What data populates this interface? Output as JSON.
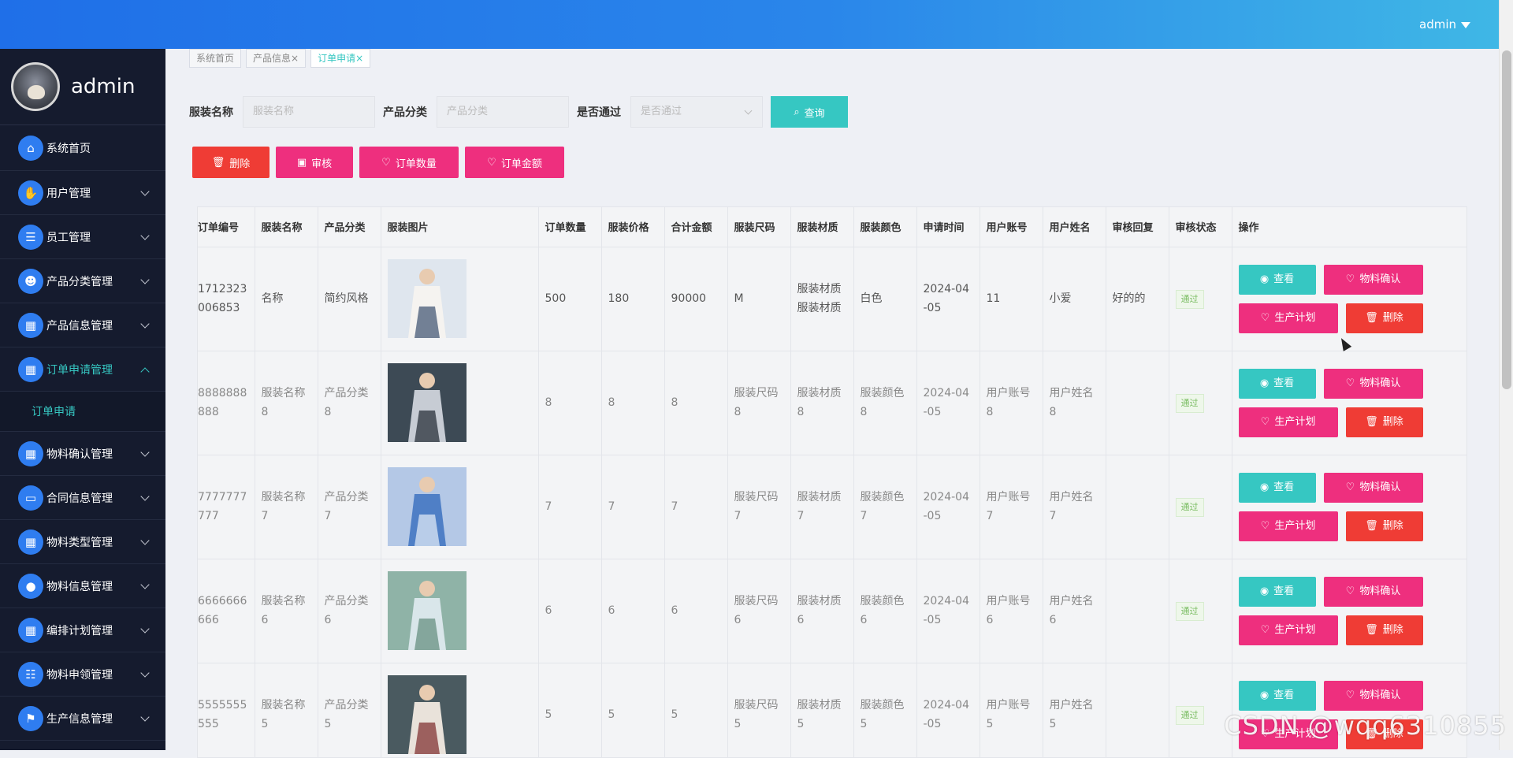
{
  "header": {
    "user": "admin"
  },
  "sidebar": {
    "profile_name": "admin",
    "items": [
      {
        "label": "系统首页",
        "icon": "home-icon",
        "glyph": "⌂"
      },
      {
        "label": "用户管理",
        "icon": "user-thumb-icon",
        "glyph": "✋"
      },
      {
        "label": "员工管理",
        "icon": "chat-icon",
        "glyph": "☰"
      },
      {
        "label": "产品分类管理",
        "icon": "person-icon",
        "glyph": "☻"
      },
      {
        "label": "产品信息管理",
        "icon": "grid-icon",
        "glyph": "▦"
      },
      {
        "label": "订单申请管理",
        "icon": "grid-icon",
        "glyph": "▦"
      },
      {
        "label": "物料确认管理",
        "icon": "grid-icon",
        "glyph": "▦"
      },
      {
        "label": "合同信息管理",
        "icon": "monitor-icon",
        "glyph": "▭"
      },
      {
        "label": "物料类型管理",
        "icon": "grid-icon",
        "glyph": "▦"
      },
      {
        "label": "物料信息管理",
        "icon": "bulb-icon",
        "glyph": "●"
      },
      {
        "label": "编排计划管理",
        "icon": "grid-icon",
        "glyph": "▦"
      },
      {
        "label": "物料申领管理",
        "icon": "sliders-icon",
        "glyph": "☷"
      },
      {
        "label": "生产信息管理",
        "icon": "flag-icon",
        "glyph": "⚑"
      }
    ],
    "submenu_label": "订单申请"
  },
  "tabs": [
    "系统首页",
    "产品信息×",
    "订单申请×"
  ],
  "search": {
    "name_label": "服装名称",
    "name_placeholder": "服装名称",
    "category_label": "产品分类",
    "category_placeholder": "产品分类",
    "pass_label": "是否通过",
    "pass_placeholder": "是否通过",
    "query_button": "查询"
  },
  "toolbar": {
    "delete": "删除",
    "review": "审核",
    "order_count": "订单数量",
    "order_amount": "订单金额"
  },
  "table": {
    "columns": [
      "订单编号",
      "服装名称",
      "产品分类",
      "服装图片",
      "订单数量",
      "服装价格",
      "合计金额",
      "服装尺码",
      "服装材质",
      "服装颜色",
      "申请时间",
      "用户账号",
      "用户姓名",
      "审核回复",
      "审核状态",
      "操作"
    ],
    "rows": [
      {
        "id": "1712323006853",
        "name": "名称",
        "category": "简约风格",
        "qty": "500",
        "price": "180",
        "total": "90000",
        "size": "M",
        "material": "服装材质服装材质",
        "color": "白色",
        "date": "2024-04-05",
        "account": "11",
        "username": "小爱",
        "reply": "好的的",
        "status": "通过"
      },
      {
        "id": "8888888888",
        "name": "服装名称8",
        "category": "产品分类8",
        "qty": "8",
        "price": "8",
        "total": "8",
        "size": "服装尺码8",
        "material": "服装材质8",
        "color": "服装颜色8",
        "date": "2024-04-05",
        "account": "用户账号8",
        "username": "用户姓名8",
        "reply": "",
        "status": "通过"
      },
      {
        "id": "7777777777",
        "name": "服装名称7",
        "category": "产品分类7",
        "qty": "7",
        "price": "7",
        "total": "7",
        "size": "服装尺码7",
        "material": "服装材质7",
        "color": "服装颜色7",
        "date": "2024-04-05",
        "account": "用户账号7",
        "username": "用户姓名7",
        "reply": "",
        "status": "通过"
      },
      {
        "id": "6666666666",
        "name": "服装名称6",
        "category": "产品分类6",
        "qty": "6",
        "price": "6",
        "total": "6",
        "size": "服装尺码6",
        "material": "服装材质6",
        "color": "服装颜色6",
        "date": "2024-04-05",
        "account": "用户账号6",
        "username": "用户姓名6",
        "reply": "",
        "status": "通过"
      },
      {
        "id": "5555555555",
        "name": "服装名称5",
        "category": "产品分类5",
        "qty": "5",
        "price": "5",
        "total": "5",
        "size": "服装尺码5",
        "material": "服装材质5",
        "color": "服装颜色5",
        "date": "2024-04-05",
        "account": "用户账号5",
        "username": "用户姓名5",
        "reply": "",
        "status": "通过"
      }
    ],
    "row_actions": {
      "view": "查看",
      "material_confirm": "物料确认",
      "production_plan": "生产计划",
      "delete": "删除"
    }
  },
  "watermark": "CSDN @wqq6310855",
  "colors": {
    "accent": "#36c7c2",
    "danger": "#ef3c35",
    "pink": "#ee2f7e",
    "sidebar": "#151b2e",
    "header": "#1f6fe8"
  }
}
